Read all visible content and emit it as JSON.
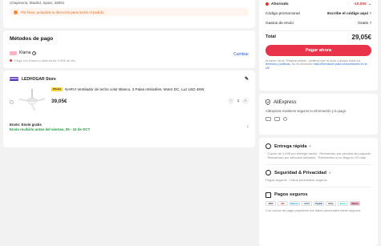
{
  "address": {
    "line": "Chapineria, Madrid, Spain, 28001",
    "warning": "Por favor, actualiza tu dirección para recibir el pedido"
  },
  "payment": {
    "title": "Métodos de pago",
    "method": "Klarna",
    "change": "Cambiar",
    "note": "Paga con Klarna y disfruta de 9,00€ de dto."
  },
  "store": {
    "name": "LEDHOGAR Store",
    "logo_text": "LEDHOGAR",
    "item": {
      "badge": "Choice",
      "title": "NARVI Ventilador de techo color Blanco, 3 Palas retráctiles, Motor DC, Luz LED 45W,",
      "price": "39,05€",
      "qty": "1",
      "minus": "−",
      "plus": "+"
    },
    "shipping_title": "Envío: Envío gratis",
    "shipping_sub": "Envío recibirlo antes del viernes, 09 - 10 de OCT"
  },
  "summary": {
    "saved_label": "Ahorrado",
    "saved_value": "-10,00€",
    "promo_label": "Código promocional",
    "promo_value": "Escribe el código aquí",
    "shipping_label": "Gastos de envío",
    "shipping_value": "Gratis",
    "total_label": "Total",
    "total_value": "29,05€",
    "pay_button": "Pagar ahora",
    "legal_1": "Al hacer clic en 'Realizar pedido', confirmo que he leído y acepto todos los ",
    "legal_link_1": "términos y políticas",
    "legal_2": ". No es necesario ",
    "legal_link_2": "más información para consumidores en la UE"
  },
  "aliexpress": {
    "title": "AliExpress",
    "desc": "AliExpress mantiene seguros tu información y tu pago"
  },
  "benefits": {
    "delivery_title": "Entrega rápida",
    "delivery_text": "· Cupón de 1,00€ por entrega tardía · Reembolso por pérdida del paquete · Reembolso por artículos dañados · Reembolso si no llega en 20 días",
    "security_title": "Seguridad & Privacidad",
    "security_text": "Pagos seguros · Datos personales seguros",
    "payments_title": "Pagos seguros",
    "payments_text": "Con socios de pago populares tus datos personales están seguros.",
    "payment_methods": [
      "VISA",
      "MC",
      "Maestro",
      "AMEX",
      "PayPal",
      "GPay",
      "Bizum",
      "Klarna"
    ]
  },
  "colors": {
    "accent": "#e8334a",
    "link": "#2567d6",
    "success": "#1f9a3e",
    "warn": "#e06b1e"
  }
}
